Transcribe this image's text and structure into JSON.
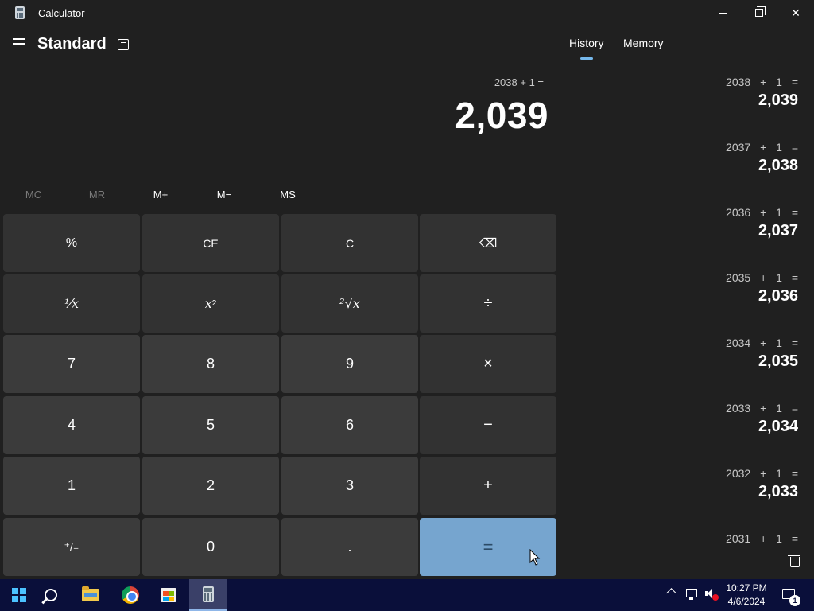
{
  "window": {
    "title": "Calculator"
  },
  "header": {
    "mode": "Standard"
  },
  "display": {
    "expression": "2038 + 1 =",
    "result": "2,039"
  },
  "memory_buttons": {
    "mc": "MC",
    "mr": "MR",
    "mplus": "M+",
    "mminus": "M−",
    "ms": "MS"
  },
  "keys": {
    "percent": "%",
    "ce": "CE",
    "c": "C",
    "backspace": "⌫",
    "reciprocal": "⅟x",
    "square_base": "x",
    "square_exp": "2",
    "sqrt": "²√x",
    "divide": "÷",
    "seven": "7",
    "eight": "8",
    "nine": "9",
    "multiply": "×",
    "four": "4",
    "five": "5",
    "six": "6",
    "minus": "−",
    "one": "1",
    "two": "2",
    "three": "3",
    "plus": "+",
    "negate": "⁺/₋",
    "zero": "0",
    "decimal": ".",
    "equals": "="
  },
  "tabs": {
    "history": "History",
    "memory": "Memory"
  },
  "history": [
    {
      "expression": "2038 + 1 =",
      "result": "2,039"
    },
    {
      "expression": "2037 + 1 =",
      "result": "2,038"
    },
    {
      "expression": "2036 + 1 =",
      "result": "2,037"
    },
    {
      "expression": "2035 + 1 =",
      "result": "2,036"
    },
    {
      "expression": "2034 + 1 =",
      "result": "2,035"
    },
    {
      "expression": "2033 + 1 =",
      "result": "2,034"
    },
    {
      "expression": "2032 + 1 =",
      "result": "2,033"
    },
    {
      "expression": "2031 + 1 =",
      "result": ""
    }
  ],
  "taskbar": {
    "time": "10:27 PM",
    "date": "4/6/2024",
    "notification_count": "1"
  },
  "colors": {
    "background": "#202020",
    "key_operator": "#323232",
    "key_number": "#3b3b3b",
    "equals": "#76a5cf",
    "accent": "#76b9ed",
    "taskbar": "#0a0f3a"
  }
}
